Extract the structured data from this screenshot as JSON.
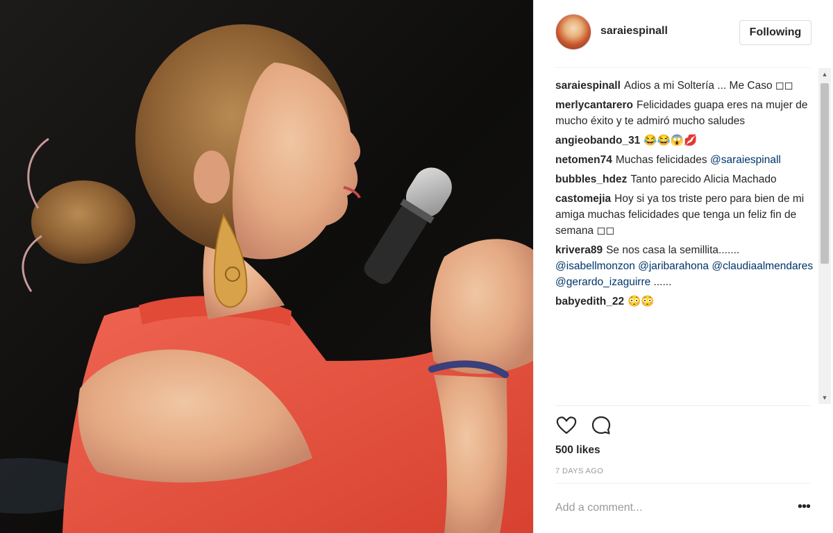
{
  "post": {
    "photo_alt": "",
    "author": "saraiespinall",
    "follow_label": "Following",
    "likes": "500 likes",
    "time_ago": "7 DAYS AGO",
    "comment_placeholder": "Add a comment...",
    "more_label": "•••",
    "like_icon": "heart-icon",
    "comment_icon": "comment-bubble-icon"
  },
  "comments": [
    {
      "user": "saraiespinall",
      "text": "Adios a mi Soltería ... Me Caso ◻◻"
    },
    {
      "user": "merlycantarero",
      "text": "Felicidades guapa eres na mujer de mucho éxito y te admiró mucho saludes"
    },
    {
      "user": "angieobando_31",
      "text": "😂😂😱💋"
    },
    {
      "user": "netomen74",
      "text": "Muchas felicidades",
      "mention": "@saraiespinall"
    },
    {
      "user": "bubbles_hdez",
      "text": "Tanto parecido Alicia Machado"
    },
    {
      "user": "castomejia",
      "text": "Hoy si ya tos triste pero para bien de mi amiga muchas felicidades que tenga un feliz fin de semana ◻◻"
    },
    {
      "user": "krivera89",
      "text": "Se nos casa la semillita.......",
      "mention": "@isabellmonzon @jaribarahona @claudiaalmendares @gerardo_izaguirre",
      "tail": "......"
    },
    {
      "user": "babyedith_22",
      "text": "😳😳"
    }
  ],
  "colors": {
    "text": "#262626",
    "muted": "#999999",
    "mention": "#003569",
    "border": "#efefef",
    "dress": "#e8503f"
  }
}
